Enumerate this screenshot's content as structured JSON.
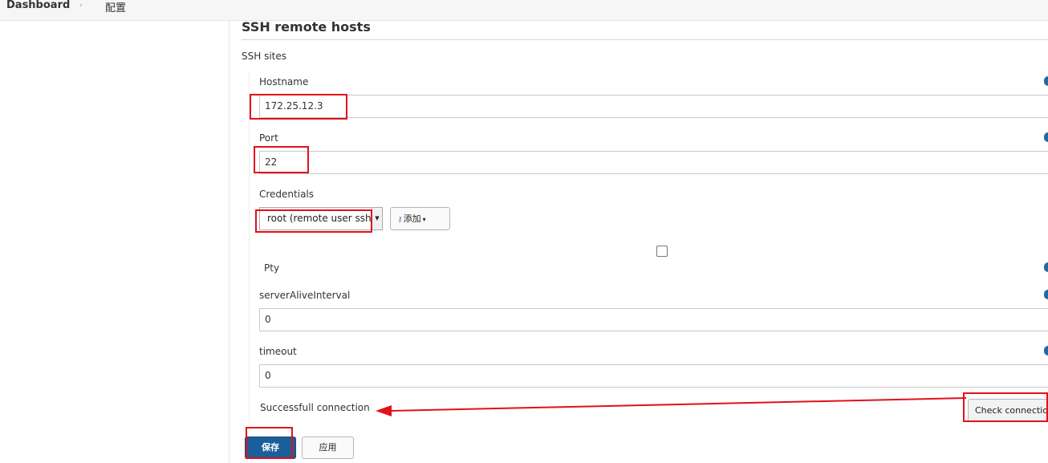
{
  "breadcrumb": {
    "dashboard": "Dashboard",
    "separator": "›",
    "current": "配置"
  },
  "section": {
    "title": "SSH remote hosts",
    "sites_label": "SSH sites"
  },
  "fields": {
    "hostname": {
      "label": "Hostname",
      "value": "172.25.12.3"
    },
    "port": {
      "label": "Port",
      "value": "22"
    },
    "credentials": {
      "label": "Credentials",
      "selected": "root (remote user ssh)",
      "arrow": "▼"
    },
    "pty": {
      "label": "Pty",
      "checked": false
    },
    "server_alive": {
      "label": "serverAliveInterval",
      "value": "0"
    },
    "timeout": {
      "label": "timeout",
      "value": "0"
    }
  },
  "add_button": {
    "icon_glyph": "⚷",
    "label": "添加",
    "caret": "▾"
  },
  "connection": {
    "status": "Successfull connection",
    "check_label": "Check connection"
  },
  "actions": {
    "save": "保存",
    "apply": "应用"
  },
  "colors": {
    "annotation": "#e2101a",
    "primary": "#1a5f99",
    "help": "#1e6aa8"
  }
}
